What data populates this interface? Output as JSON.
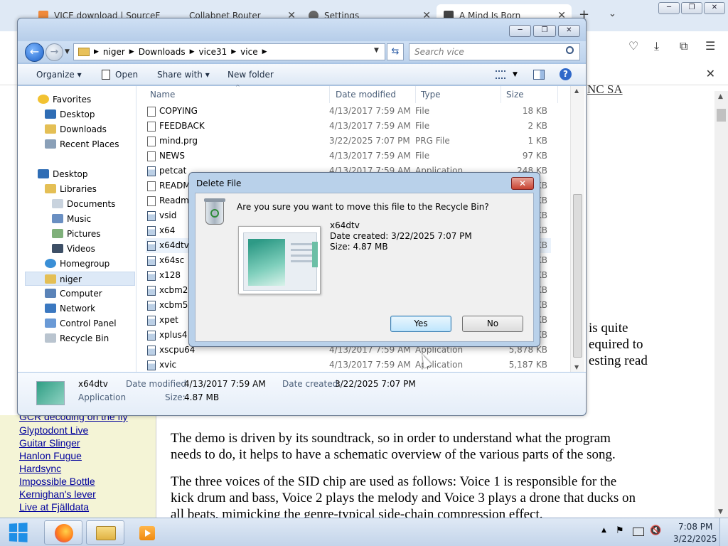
{
  "browser": {
    "tabs": [
      {
        "title": "VICE download | SourceF"
      },
      {
        "title": "Collabnet Router"
      },
      {
        "title": "Settings"
      },
      {
        "title": "A Mind Is Born"
      }
    ],
    "new_tab": "+",
    "tab_list": "⌄",
    "close_glyph": "✕",
    "win_min": "─",
    "win_max": "❐",
    "win_close": "✕",
    "partial_text": "NC SA",
    "sidebar_links": [
      "GCR decoding on the fly",
      "Glyptodont Live",
      "Guitar Slinger",
      "Hanlon Fugue",
      "Hardsync",
      "Impossible Bottle",
      "Kernighan's lever",
      "Live at Fjälldata"
    ],
    "article": {
      "frag1": "is quite",
      "frag2": "equired to",
      "frag3": "esting read",
      "p1_l1": "The demo is driven by its soundtrack, so in order to understand what the program",
      "p1_l2": "needs to do, it helps to have a schematic overview of the various parts of the song.",
      "p2_l1": "The three voices of the SID chip are used as follows: Voice 1 is responsible for the",
      "p2_l2": "kick drum and bass, Voice 2 plays the melody and Voice 3 plays a drone that ducks on",
      "p2_l3": "all beats, mimicking the genre-typical side-chain compression effect."
    }
  },
  "explorer": {
    "path": [
      "niger",
      "Downloads",
      "vice31",
      "vice"
    ],
    "search_placeholder": "Search vice",
    "toolbar": {
      "organize": "Organize ▾",
      "open": "Open",
      "share": "Share with ▾",
      "new_folder": "New folder"
    },
    "nav": {
      "favorites": "Favorites",
      "desktop": "Desktop",
      "downloads": "Downloads",
      "recent": "Recent Places",
      "desktop2": "Desktop",
      "libraries": "Libraries",
      "documents": "Documents",
      "music": "Music",
      "pictures": "Pictures",
      "videos": "Videos",
      "homegroup": "Homegroup",
      "user": "niger",
      "computer": "Computer",
      "network": "Network",
      "control_panel": "Control Panel",
      "recycle_bin": "Recycle Bin"
    },
    "columns": {
      "name": "Name",
      "date": "Date modified",
      "type": "Type",
      "size": "Size"
    },
    "files": [
      {
        "name": "COPYING",
        "date": "4/13/2017 7:59 AM",
        "type": "File",
        "size": "18 KB"
      },
      {
        "name": "FEEDBACK",
        "date": "4/13/2017 7:59 AM",
        "type": "File",
        "size": "2 KB"
      },
      {
        "name": "mind.prg",
        "date": "3/22/2025 7:07 PM",
        "type": "PRG File",
        "size": "1 KB"
      },
      {
        "name": "NEWS",
        "date": "4/13/2017 7:59 AM",
        "type": "File",
        "size": "97 KB"
      },
      {
        "name": "petcat",
        "date": "4/13/2017 7:59 AM",
        "type": "Application",
        "size": "248 KB"
      },
      {
        "name": "README",
        "date": "",
        "type": "",
        "size": "KB"
      },
      {
        "name": "Readme",
        "date": "",
        "type": "",
        "size": "KB"
      },
      {
        "name": "vsid",
        "date": "",
        "type": "",
        "size": "KB"
      },
      {
        "name": "x64",
        "date": "",
        "type": "",
        "size": "KB"
      },
      {
        "name": "x64dtv",
        "date": "",
        "type": "",
        "size": "KB"
      },
      {
        "name": "x64sc",
        "date": "",
        "type": "",
        "size": "KB"
      },
      {
        "name": "x128",
        "date": "",
        "type": "",
        "size": "KB"
      },
      {
        "name": "xcbm2",
        "date": "",
        "type": "",
        "size": "KB"
      },
      {
        "name": "xcbm5x0",
        "date": "",
        "type": "",
        "size": "KB"
      },
      {
        "name": "xpet",
        "date": "",
        "type": "",
        "size": "KB"
      },
      {
        "name": "xplus4",
        "date": "",
        "type": "",
        "size": "KB"
      },
      {
        "name": "xscpu64",
        "date": "4/13/2017 7:59 AM",
        "type": "Application",
        "size": "5,878 KB"
      },
      {
        "name": "xvic",
        "date": "4/13/2017 7:59 AM",
        "type": "Application",
        "size": "5,187 KB"
      }
    ],
    "details": {
      "name": "x64dtv",
      "kind": "Application",
      "modified_label": "Date modified:",
      "modified_value": "4/13/2017 7:59 AM",
      "created_label": "Date created:",
      "created_value": "3/22/2025 7:07 PM",
      "size_label": "Size:",
      "size_value": "4.87 MB"
    }
  },
  "dialog": {
    "title": "Delete File",
    "close": "✕",
    "question": "Are you sure you want to move this file to the Recycle Bin?",
    "file_name": "x64dtv",
    "date_created": "Date created: 3/22/2025 7:07 PM",
    "size": "Size: 4.87 MB",
    "yes": "Yes",
    "no": "No"
  },
  "taskbar": {
    "time": "7:08 PM",
    "date": "3/22/2025"
  }
}
